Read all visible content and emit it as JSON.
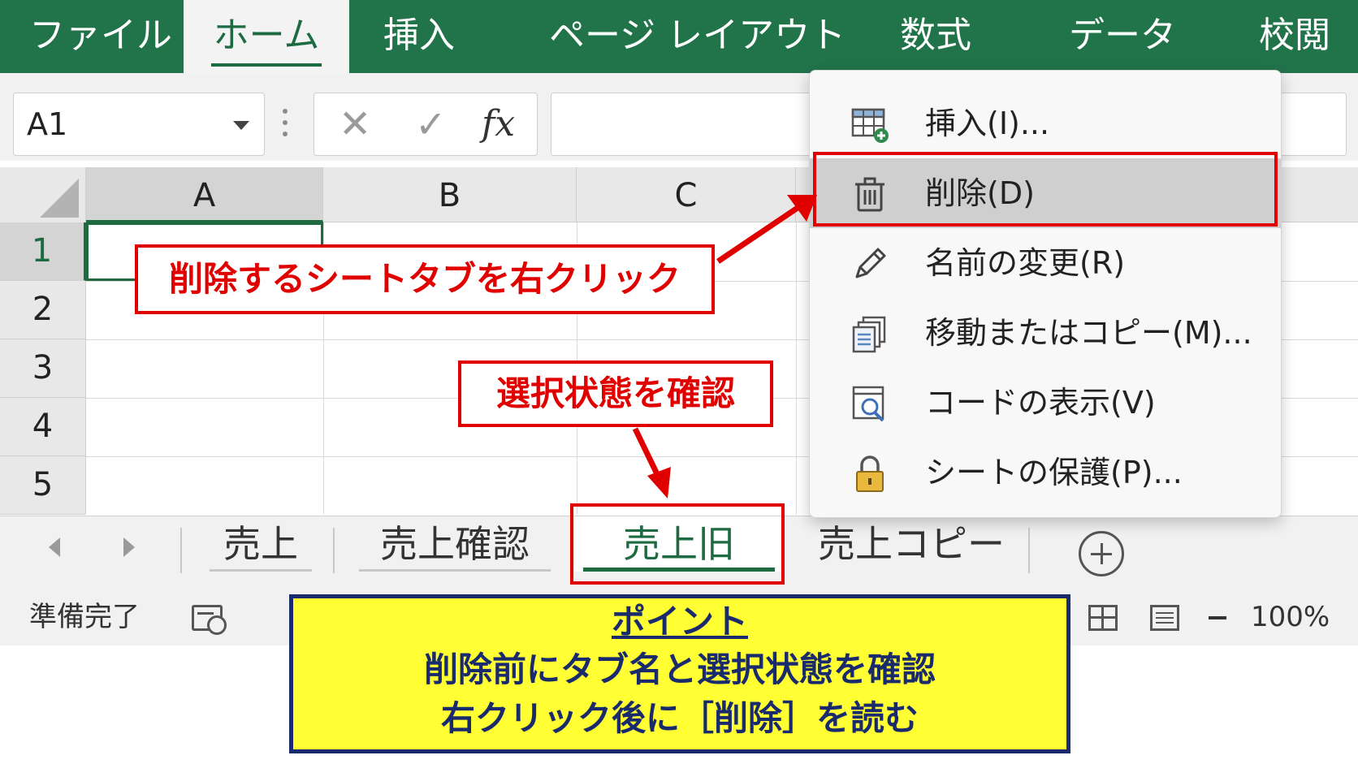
{
  "ribbon": {
    "tabs": [
      {
        "label": "ファイル"
      },
      {
        "label": "ホーム"
      },
      {
        "label": "挿入"
      },
      {
        "label": "ページ レイアウト"
      },
      {
        "label": "数式"
      },
      {
        "label": "データ"
      },
      {
        "label": "校閲"
      }
    ],
    "active_tab": "ホーム"
  },
  "formula_bar": {
    "name_box": "A1",
    "cancel_icon": "✕",
    "enter_icon": "✓",
    "fx_label": "fx",
    "value": ""
  },
  "grid": {
    "columns": [
      "A",
      "B",
      "C"
    ],
    "rows": [
      "1",
      "2",
      "3",
      "4",
      "5"
    ],
    "selected_cell": "A1"
  },
  "context_menu": {
    "items": [
      {
        "label": "挿入(I)...",
        "icon": "insert-sheet-icon"
      },
      {
        "label": "削除(D)",
        "icon": "trash-icon",
        "highlighted": true
      },
      {
        "label": "名前の変更(R)",
        "icon": "pencil-icon"
      },
      {
        "label": "移動またはコピー(M)...",
        "icon": "copy-sheets-icon"
      },
      {
        "label": "コードの表示(V)",
        "icon": "view-code-icon"
      },
      {
        "label": "シートの保護(P)...",
        "icon": "lock-icon"
      }
    ]
  },
  "sheet_tabs": {
    "tabs": [
      {
        "label": "売上"
      },
      {
        "label": "売上確認"
      },
      {
        "label": "売上旧",
        "active": true
      },
      {
        "label": "売上コピー"
      }
    ]
  },
  "status_bar": {
    "ready": "準備完了",
    "zoom": "100%"
  },
  "annotations": {
    "callout_right_click": "削除するシートタブを右クリック",
    "callout_check_selection": "選択状態を確認",
    "point": {
      "title": "ポイント",
      "line1": "削除前にタブ名と選択状態を確認",
      "line2": "右クリック後に［削除］を読む"
    }
  },
  "colors": {
    "excel_green": "#21734a",
    "annotation_red": "#e00000",
    "point_yellow": "#ffff33",
    "point_navy": "#1a2b6d"
  }
}
